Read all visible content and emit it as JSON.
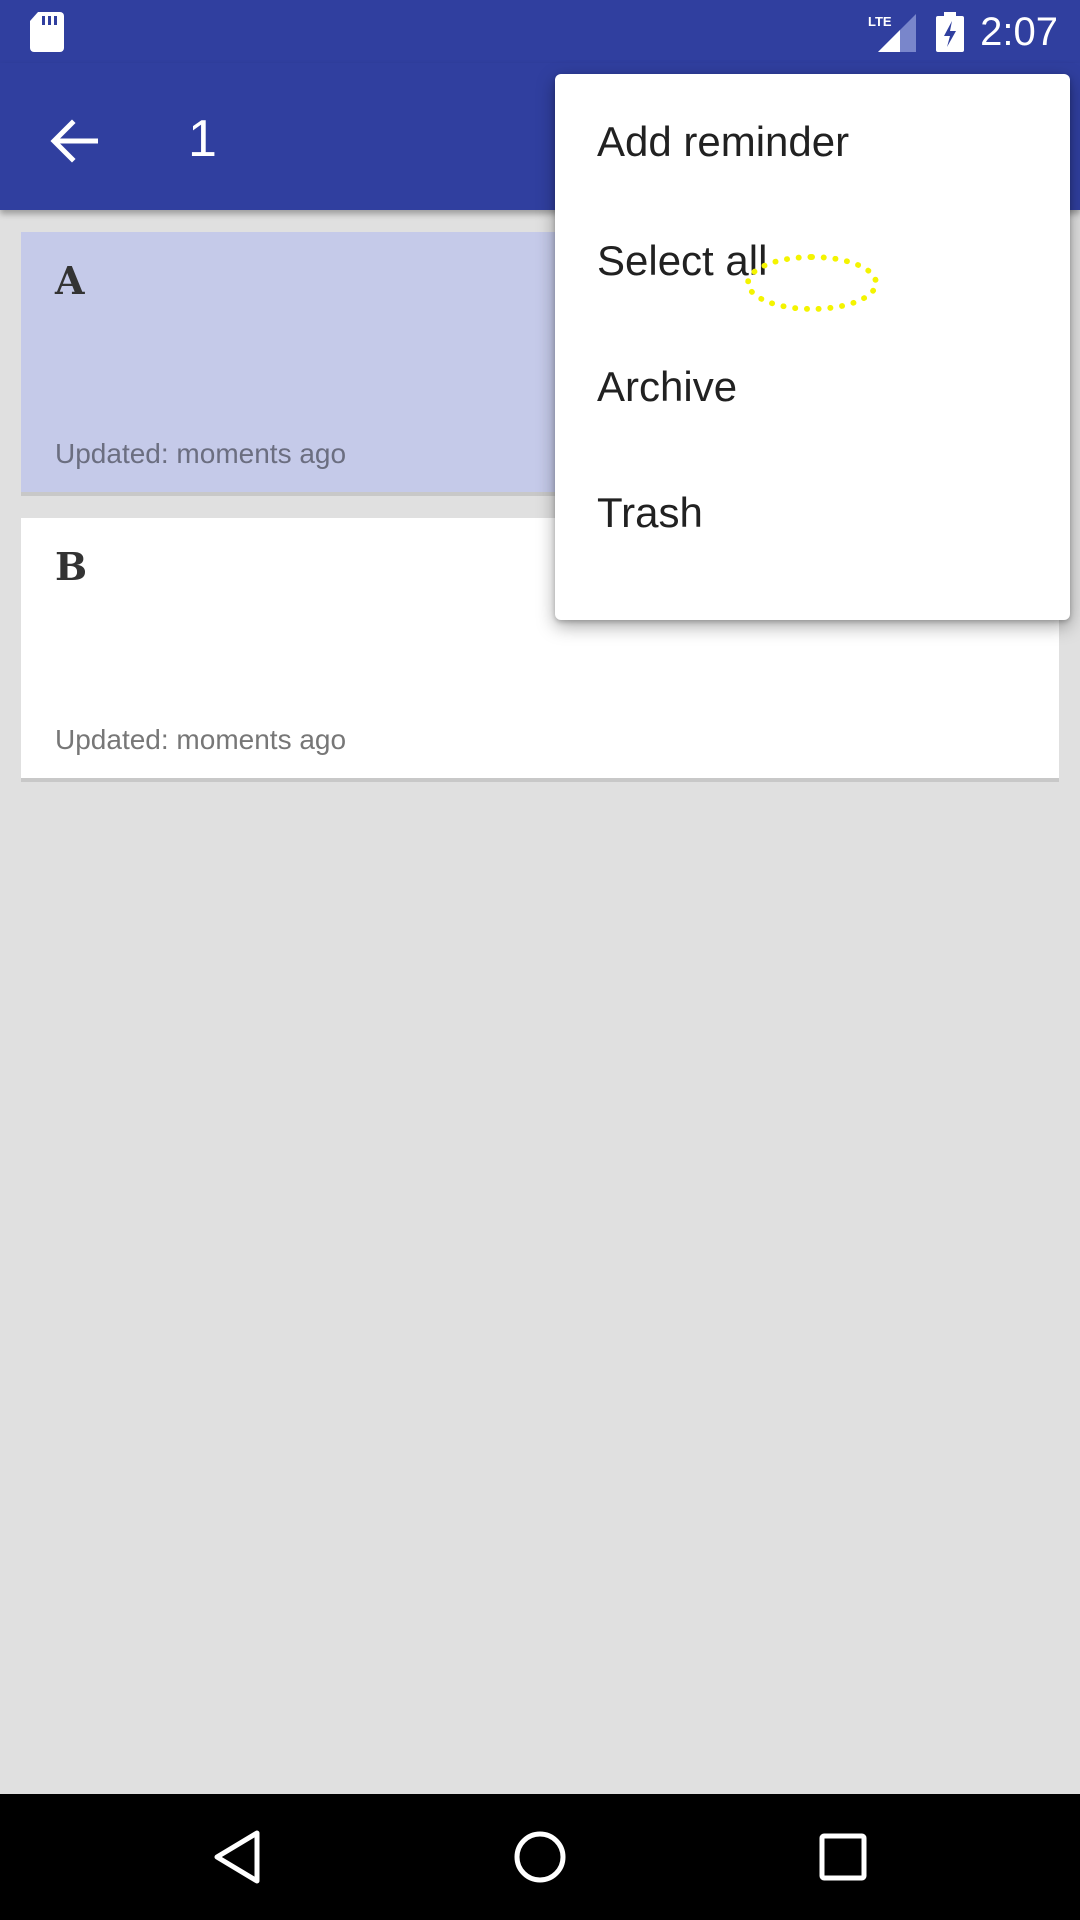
{
  "status_bar": {
    "time": "2:07",
    "network": "LTE",
    "icons": [
      "sd-card-icon",
      "lte-signal-icon",
      "battery-charging-icon"
    ]
  },
  "app_bar": {
    "selection_count": "1",
    "back_icon": "arrow-back-icon",
    "color": "#303f9f"
  },
  "notes": [
    {
      "title": "A",
      "updated": "Updated: moments ago",
      "selected": true
    },
    {
      "title": "B",
      "updated": "Updated: moments ago",
      "selected": false
    }
  ],
  "menu": {
    "items": [
      "Add reminder",
      "Select all",
      "Archive",
      "Trash"
    ]
  },
  "nav_bar": {
    "icons": [
      "back-triangle-icon",
      "home-circle-icon",
      "recents-square-icon"
    ]
  },
  "colors": {
    "primary": "#303f9f",
    "selected_card": "#c5cae9",
    "background": "#e0e0e0"
  }
}
